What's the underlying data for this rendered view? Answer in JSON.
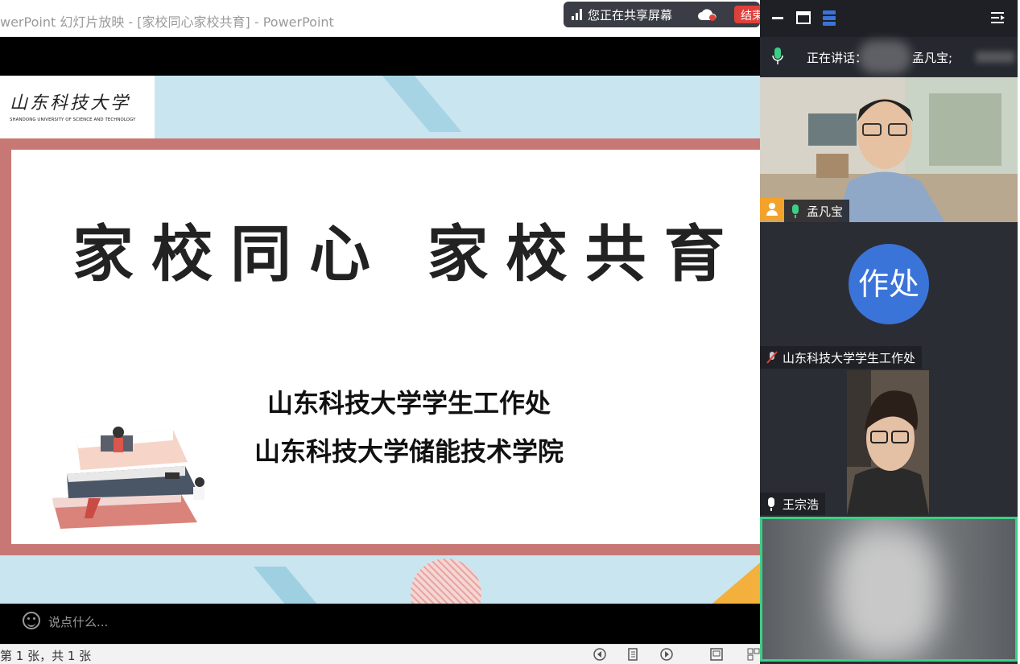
{
  "ppt": {
    "window_title": "werPoint 幻灯片放映 - [家校同心家校共育] - PowerPoint",
    "status_text": "第 1 张，共 1 张"
  },
  "share": {
    "label": "您正在共享屏幕",
    "end_label": "结束"
  },
  "slide": {
    "logo_cn": "山东科技大学",
    "logo_en": "SHANDONG UNIVERSITY OF SCIENCE AND TECHNOLOGY",
    "title": "家校同心 家校共育",
    "org_1": "山东科技大学学生工作处",
    "org_2": "山东科技大学储能技术学院"
  },
  "chat": {
    "placeholder": "说点什么..."
  },
  "meeting": {
    "speaking_label": "正在讲话：",
    "speaking_name": "孟凡宝;",
    "participants": [
      {
        "name": "孟凡宝",
        "mic": "on"
      },
      {
        "name": "山东科技大学学生工作处",
        "avatar_text": "作处",
        "mic": "muted"
      },
      {
        "name": "王宗浩",
        "mic": "on"
      },
      {
        "name": "",
        "mic": "on"
      }
    ]
  },
  "colors": {
    "accent_blue": "#3b74d8",
    "active_speaker": "#3bcf84",
    "end_red": "#e0403a",
    "slide_frame": "#c87874"
  }
}
